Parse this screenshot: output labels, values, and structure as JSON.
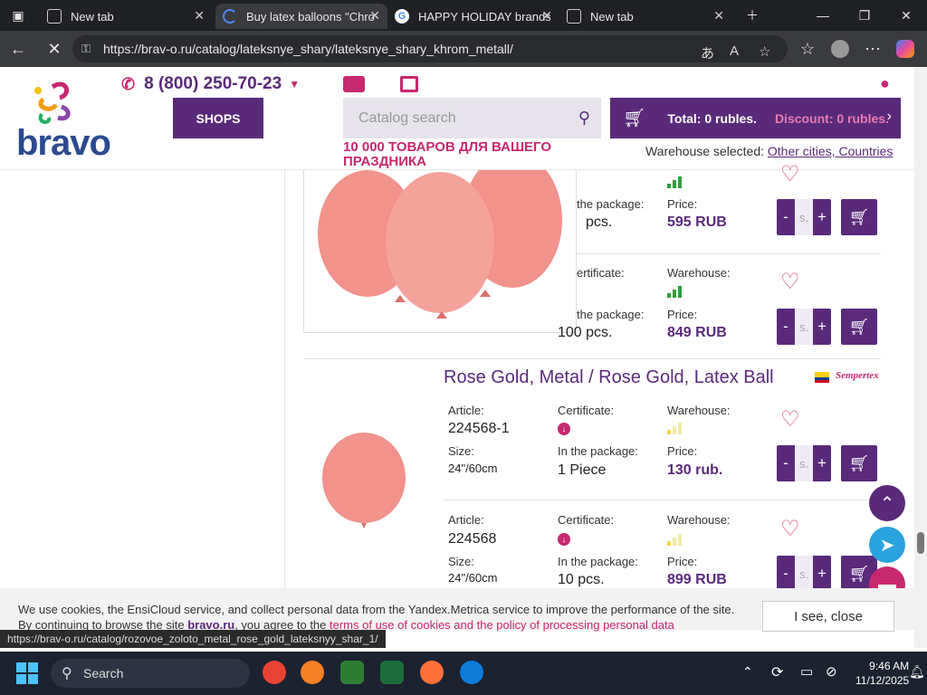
{
  "browser": {
    "tabs": [
      {
        "title": "New tab",
        "icon": "window-icon"
      },
      {
        "title": "Buy latex balloons \"Chro",
        "icon": "loading-icon"
      },
      {
        "title": "HAPPY HOLIDAY brands",
        "icon": "google-icon"
      },
      {
        "title": "New tab",
        "icon": "window-icon"
      }
    ],
    "url": "https://brav-o.ru/catalog/lateksnye_shary/lateksnye_shary_khrom_metall/",
    "status_url": "https://brav-o.ru/catalog/rozovoe_zoloto_metal_rose_gold_lateksnyy_shar_1/"
  },
  "header": {
    "logo": "bravo",
    "phone": "8 (800) 250-70-23",
    "shops_label": "SHOPS",
    "search_placeholder": "Catalog search",
    "slogan": "10 000 ТОВАРОВ ДЛЯ ВАШЕГО ПРАЗДНИКА",
    "cart_total": "Total: 0 rubles.",
    "cart_discount": "Discount: 0 rubles.",
    "warehouse_label": "Warehouse selected:",
    "warehouse_link": "Other cities, Countries"
  },
  "products": {
    "first": {
      "rows": [
        {
          "pkg_label": "the package:",
          "pkg_value": "pcs.",
          "price_label": "Price:",
          "price": "595 RUB"
        },
        {
          "cert_label": "ertificate:",
          "warehouse_label": "Warehouse:",
          "pkg_label": "the package:",
          "pkg_value": "100 pcs.",
          "price_label": "Price:",
          "price": "849 RUB"
        }
      ]
    },
    "second": {
      "title": "Rose Gold, Metal / Rose Gold, Latex Ball",
      "brand": "Sempertex",
      "rows": [
        {
          "article_label": "Article:",
          "article": "224568-1",
          "cert_label": "Certificate:",
          "warehouse_label": "Warehouse:",
          "size_label": "Size:",
          "size": "24\"/60cm",
          "pkg_label": "In the package:",
          "pkg_value": "1 Piece",
          "price_label": "Price:",
          "price": "130 rub."
        },
        {
          "article_label": "Article:",
          "article": "224568",
          "cert_label": "Certificate:",
          "warehouse_label": "Warehouse:",
          "size_label": "Size:",
          "size": "24\"/60cm",
          "pkg_label": "In the package:",
          "pkg_value": "10 pcs.",
          "price_label": "Price:",
          "price": "899 RUB"
        }
      ]
    },
    "qty_placeholder": "s."
  },
  "cookie": {
    "line1": "We use cookies, the EnsiCloud service, and collect personal data from the Yandex.Metrica service to improve the performance of the site.",
    "line2_a": "By continuing to browse the site",
    "line2_brand": "bravo.ru",
    "line2_b": ", you agree to the",
    "line2_link": "terms of use of cookies and the policy of processing personal data",
    "button": "I see, close"
  },
  "taskbar": {
    "search_label": "Search",
    "time": "9:46 AM",
    "date": "11/12/2025"
  },
  "colors": {
    "brand_purple": "#5a2a7a",
    "brand_pink": "#c8286e"
  }
}
